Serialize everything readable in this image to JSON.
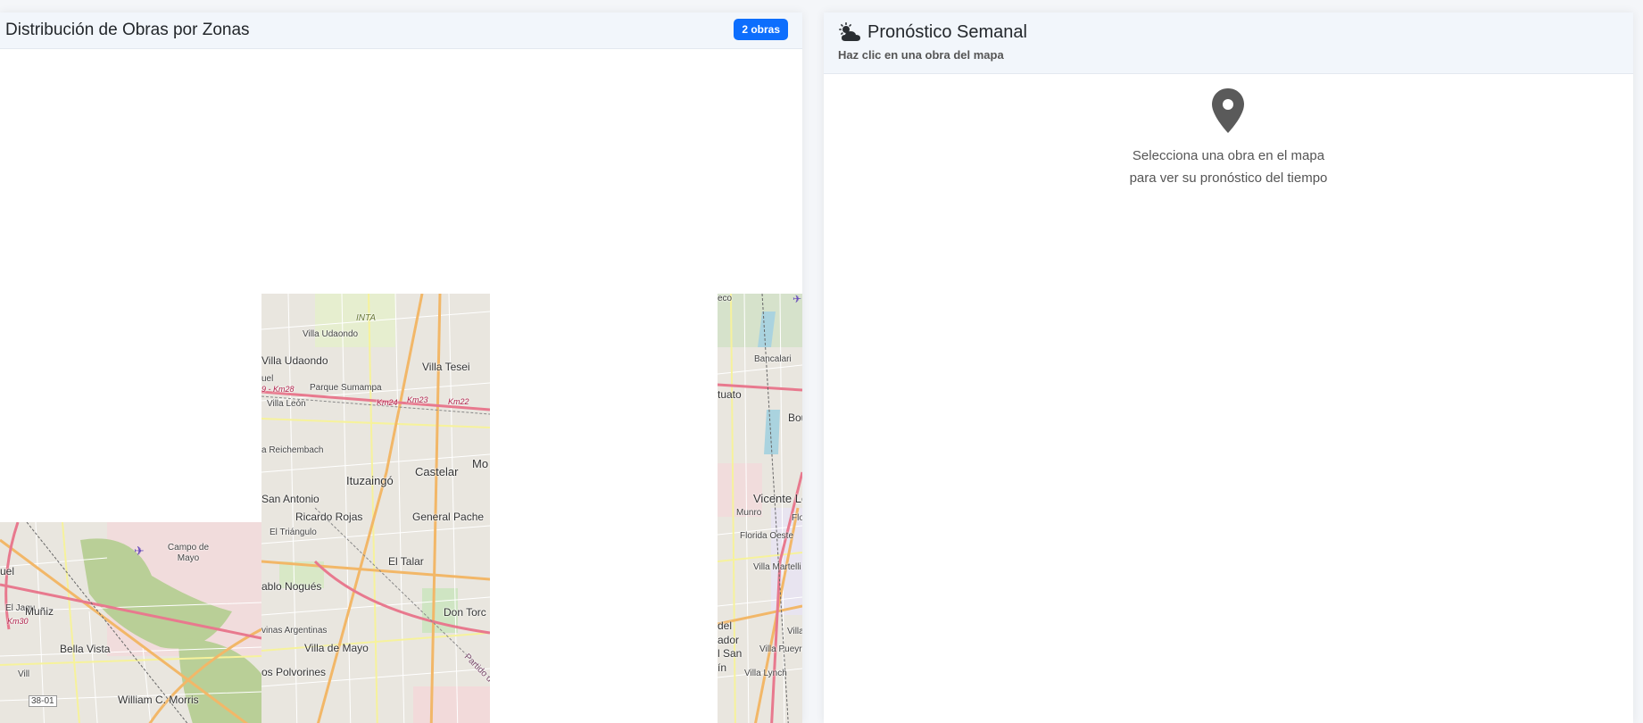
{
  "left_panel": {
    "title": "Distribución de Obras por Zonas",
    "badge": "2 obras"
  },
  "map": {
    "labels": [
      "INTA",
      "Villa Udaondo",
      "Villa Udaondo",
      "Villa Tesei",
      "uel",
      "Parque Sumampa",
      "9 - Km28",
      "Km24",
      "Km23",
      "Km22",
      "Villa León",
      "a Reichembach",
      "Mo",
      "Castelar",
      "Ituzaingó",
      "San Antonio",
      "Ricardo Rojas",
      "General Pache",
      "El Triángulo",
      "El Talar",
      "ablo Nogués",
      "Don Torc",
      "vinas Argentinas",
      "Villa de Mayo",
      "os Polvorines",
      "Partido de",
      "Campo de Mayo",
      "uel",
      "El Jagu",
      "Muñiz",
      "Km30",
      "Bella Vista",
      "Vill",
      "William C. Morris",
      "38-01",
      "eco",
      "Bancalari",
      "tuato",
      "Bou",
      "Vicente Lóp",
      "Munro",
      "Flo",
      "Florida Oeste",
      "Villa Martelli",
      "del",
      "ador",
      "Villa",
      "l San",
      "Villa Pueyrred",
      "Villa Lynch",
      "ín"
    ]
  },
  "right_panel": {
    "icon": "cloud-sun-icon",
    "title": "Pronóstico Semanal",
    "subtitle": "Haz clic en una obra del mapa",
    "placeholder_icon": "map-pin-icon",
    "message_line1": "Selecciona una obra en el mapa",
    "message_line2": "para ver su pronóstico del tiempo"
  },
  "colors": {
    "badge": "#0d6efd",
    "header_bg": "#f2f6fb",
    "pin": "#5a5a5a"
  }
}
